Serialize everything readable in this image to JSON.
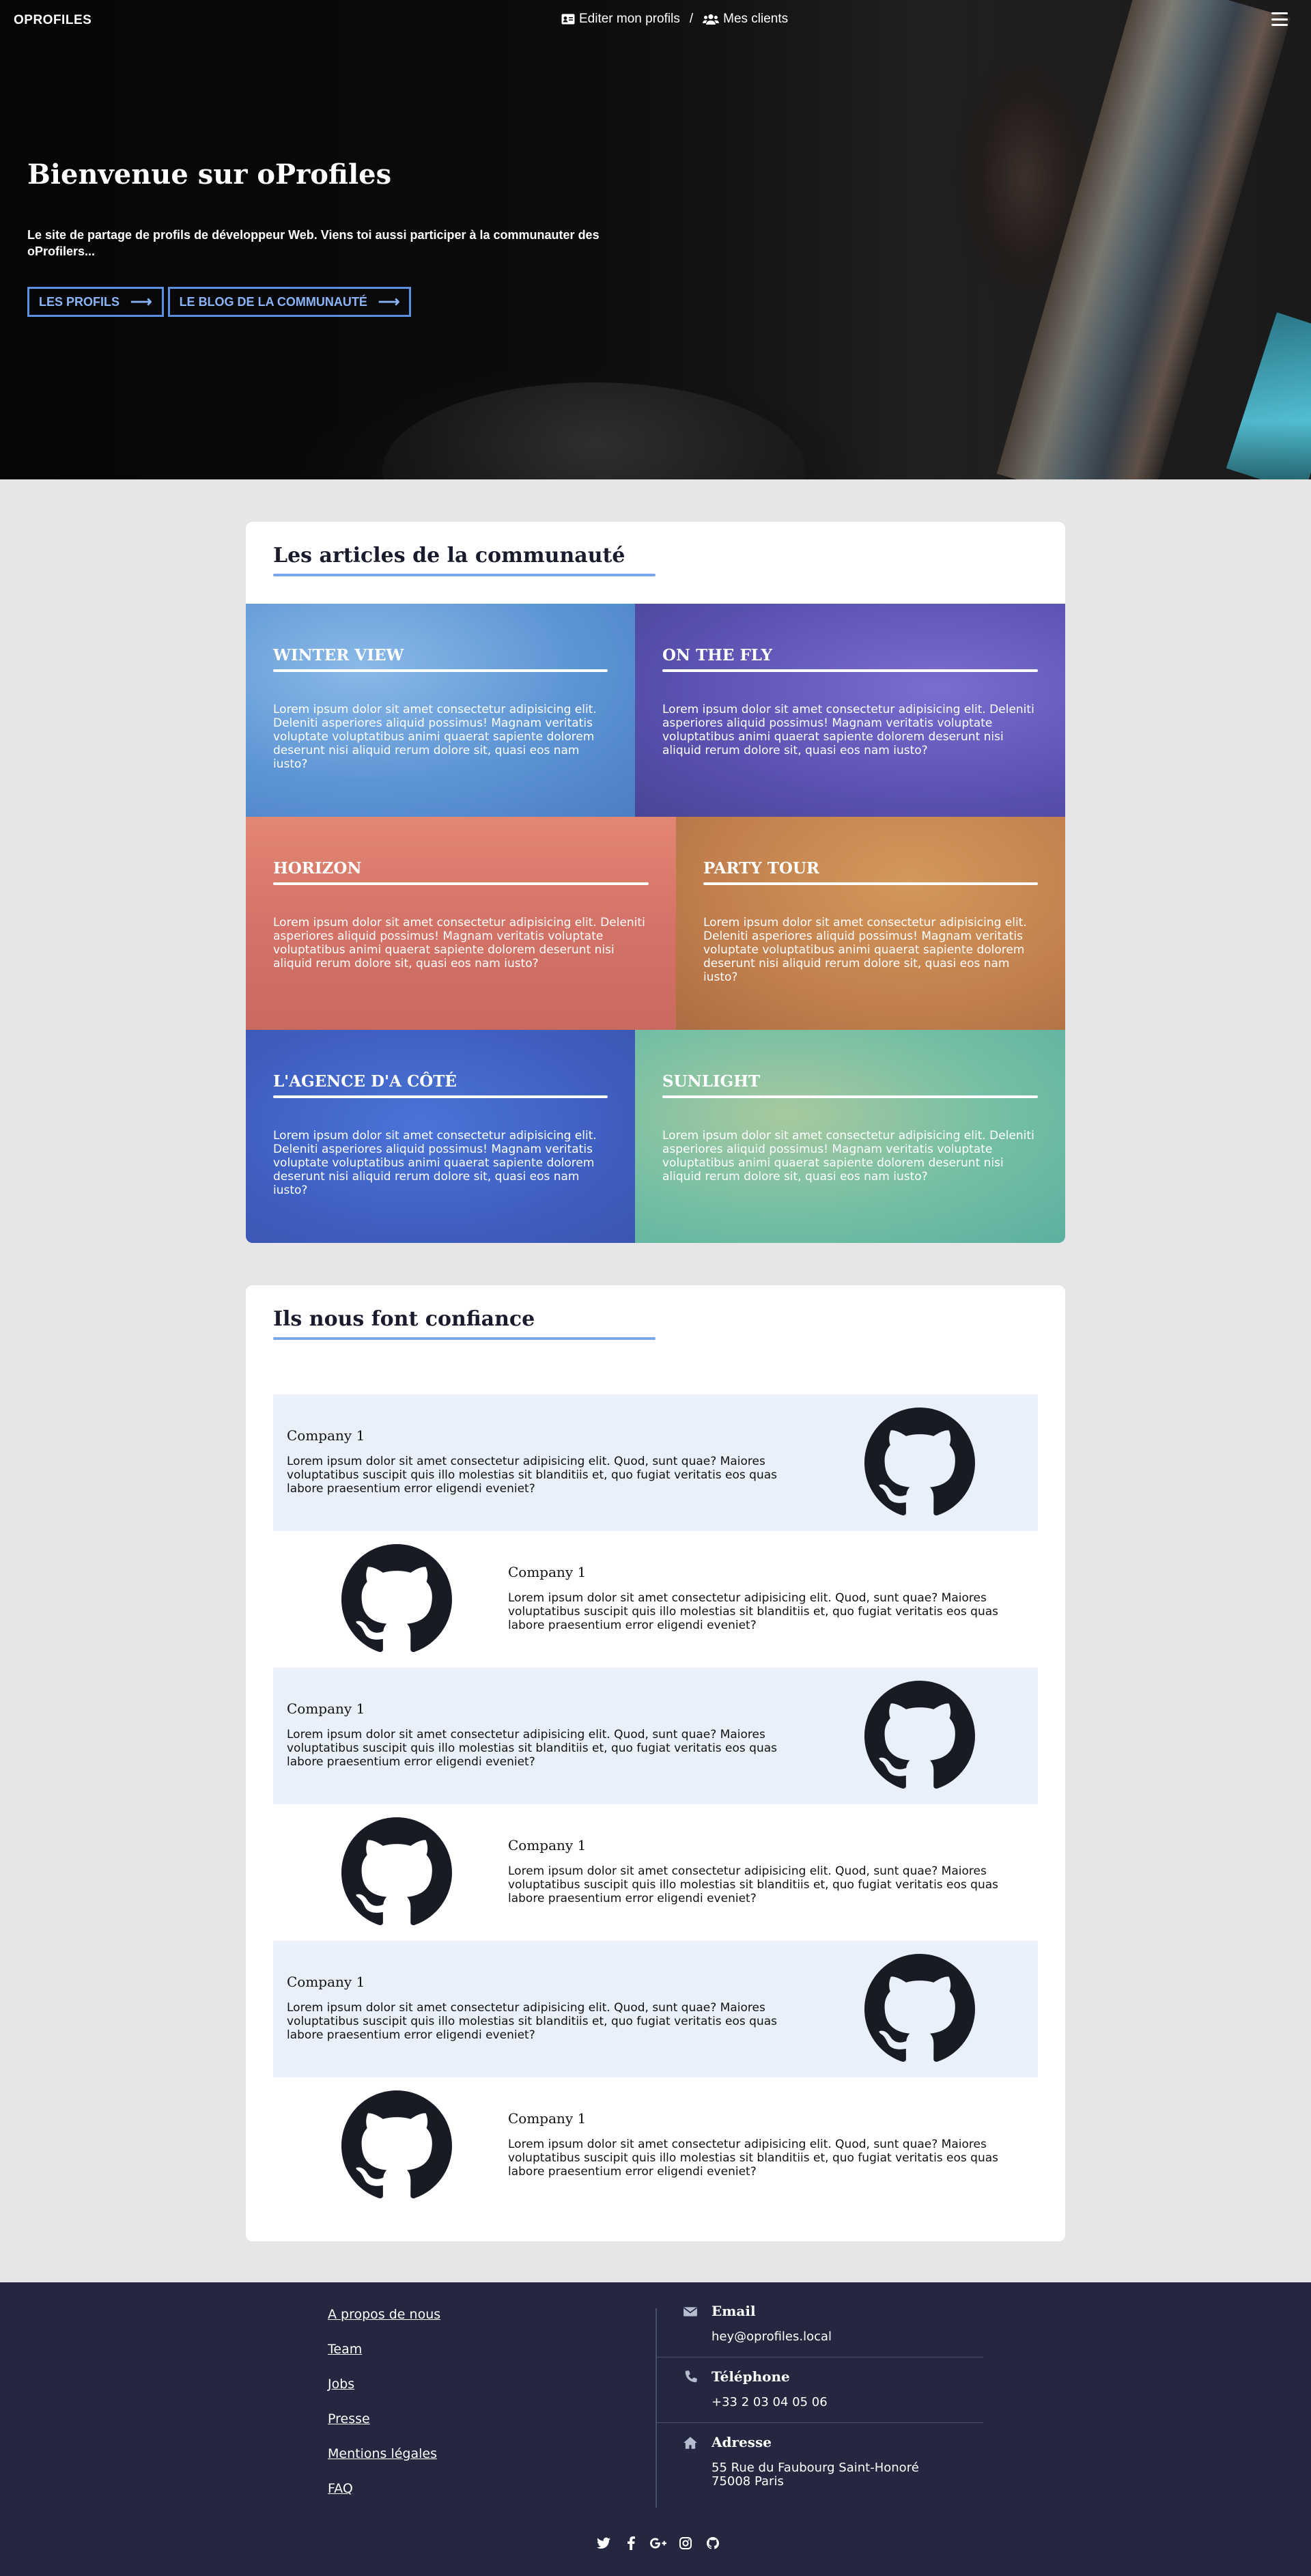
{
  "nav": {
    "brand": "OPROFILES",
    "links": [
      {
        "label": "Editer mon profils",
        "icon": "id-card-icon"
      },
      {
        "label": "Mes clients",
        "icon": "users-icon"
      }
    ],
    "separator": "/",
    "menu_icon": "hamburger-menu-icon"
  },
  "hero": {
    "title": "Bienvenue sur oProfiles",
    "text": "Le site de partage de profils de développeur Web. Viens toi aussi participer à la communauter des oProfilers...",
    "buttons": [
      {
        "label": "LES PROFILS",
        "icon": "arrow-right-icon"
      },
      {
        "label": "LE BLOG DE LA COMMUNAUTÉ",
        "icon": "arrow-right-icon"
      }
    ]
  },
  "articles": {
    "title": "Les articles de la communauté",
    "items": [
      {
        "title": "WINTER VIEW",
        "text": "Lorem ipsum dolor sit amet consectetur adipisicing elit. Deleniti asperiores aliquid possimus! Magnam veritatis voluptate voluptatibus animi quaerat sapiente dolorem deserunt nisi aliquid rerum dolore sit, quasi eos nam iusto?"
      },
      {
        "title": "ON THE FLY",
        "text": "Lorem ipsum dolor sit amet consectetur adipisicing elit. Deleniti asperiores aliquid possimus! Magnam veritatis voluptate voluptatibus animi quaerat sapiente dolorem deserunt nisi aliquid rerum dolore sit, quasi eos nam iusto?"
      },
      {
        "title": "HORIZON",
        "text": "Lorem ipsum dolor sit amet consectetur adipisicing elit. Deleniti asperiores aliquid possimus! Magnam veritatis voluptate voluptatibus animi quaerat sapiente dolorem deserunt nisi aliquid rerum dolore sit, quasi eos nam iusto?"
      },
      {
        "title": "PARTY TOUR",
        "text": "Lorem ipsum dolor sit amet consectetur adipisicing elit. Deleniti asperiores aliquid possimus! Magnam veritatis voluptate voluptatibus animi quaerat sapiente dolorem deserunt nisi aliquid rerum dolore sit, quasi eos nam iusto?"
      },
      {
        "title": "L'AGENCE D'A CÔTÉ",
        "text": "Lorem ipsum dolor sit amet consectetur adipisicing elit. Deleniti asperiores aliquid possimus! Magnam veritatis voluptate voluptatibus animi quaerat sapiente dolorem deserunt nisi aliquid rerum dolore sit, quasi eos nam iusto?"
      },
      {
        "title": "SUNLIGHT",
        "text": "Lorem ipsum dolor sit amet consectetur adipisicing elit. Deleniti asperiores aliquid possimus! Magnam veritatis voluptate voluptatibus animi quaerat sapiente dolorem deserunt nisi aliquid rerum dolore sit, quasi eos nam iusto?"
      }
    ]
  },
  "clients": {
    "title": "Ils nous font confiance",
    "items": [
      {
        "name": "Company 1",
        "text": "Lorem ipsum dolor sit amet consectetur adipisicing elit. Quod, sunt quae? Maiores voluptatibus suscipit quis illo molestias sit blanditiis et, quo fugiat veritatis eos quas labore praesentium error eligendi eveniet?",
        "logo": "github-logo-icon"
      },
      {
        "name": "Company 1",
        "text": "Lorem ipsum dolor sit amet consectetur adipisicing elit. Quod, sunt quae? Maiores voluptatibus suscipit quis illo molestias sit blanditiis et, quo fugiat veritatis eos quas labore praesentium error eligendi eveniet?",
        "logo": "github-logo-icon"
      },
      {
        "name": "Company 1",
        "text": "Lorem ipsum dolor sit amet consectetur adipisicing elit. Quod, sunt quae? Maiores voluptatibus suscipit quis illo molestias sit blanditiis et, quo fugiat veritatis eos quas labore praesentium error eligendi eveniet?",
        "logo": "github-logo-icon"
      },
      {
        "name": "Company 1",
        "text": "Lorem ipsum dolor sit amet consectetur adipisicing elit. Quod, sunt quae? Maiores voluptatibus suscipit quis illo molestias sit blanditiis et, quo fugiat veritatis eos quas labore praesentium error eligendi eveniet?",
        "logo": "github-logo-icon"
      },
      {
        "name": "Company 1",
        "text": "Lorem ipsum dolor sit amet consectetur adipisicing elit. Quod, sunt quae? Maiores voluptatibus suscipit quis illo molestias sit blanditiis et, quo fugiat veritatis eos quas labore praesentium error eligendi eveniet?",
        "logo": "github-logo-icon"
      },
      {
        "name": "Company 1",
        "text": "Lorem ipsum dolor sit amet consectetur adipisicing elit. Quod, sunt quae? Maiores voluptatibus suscipit quis illo molestias sit blanditiis et, quo fugiat veritatis eos quas labore praesentium error eligendi eveniet?",
        "logo": "github-logo-icon"
      }
    ]
  },
  "footer": {
    "links": [
      "A propos de nous",
      "Team",
      "Jobs",
      "Presse",
      "Mentions légales",
      "FAQ"
    ],
    "contact": [
      {
        "label": "Email",
        "value": "hey@oprofiles.local",
        "icon": "envelope-icon"
      },
      {
        "label": "Téléphone",
        "value": "+33 2 03 04 05 06",
        "icon": "phone-icon"
      },
      {
        "label": "Adresse",
        "value": "55 Rue du Faubourg Saint-Honoré\n75008 Paris",
        "icon": "home-icon"
      }
    ],
    "socials": [
      "twitter-icon",
      "facebook-icon",
      "google-plus-icon",
      "instagram-icon",
      "github-icon"
    ]
  },
  "colors": {
    "accent": "#5b8fe0",
    "footer_bg": "#24273f",
    "page_bg": "#e6e6e6",
    "client_tint": "#eaf0fa"
  }
}
